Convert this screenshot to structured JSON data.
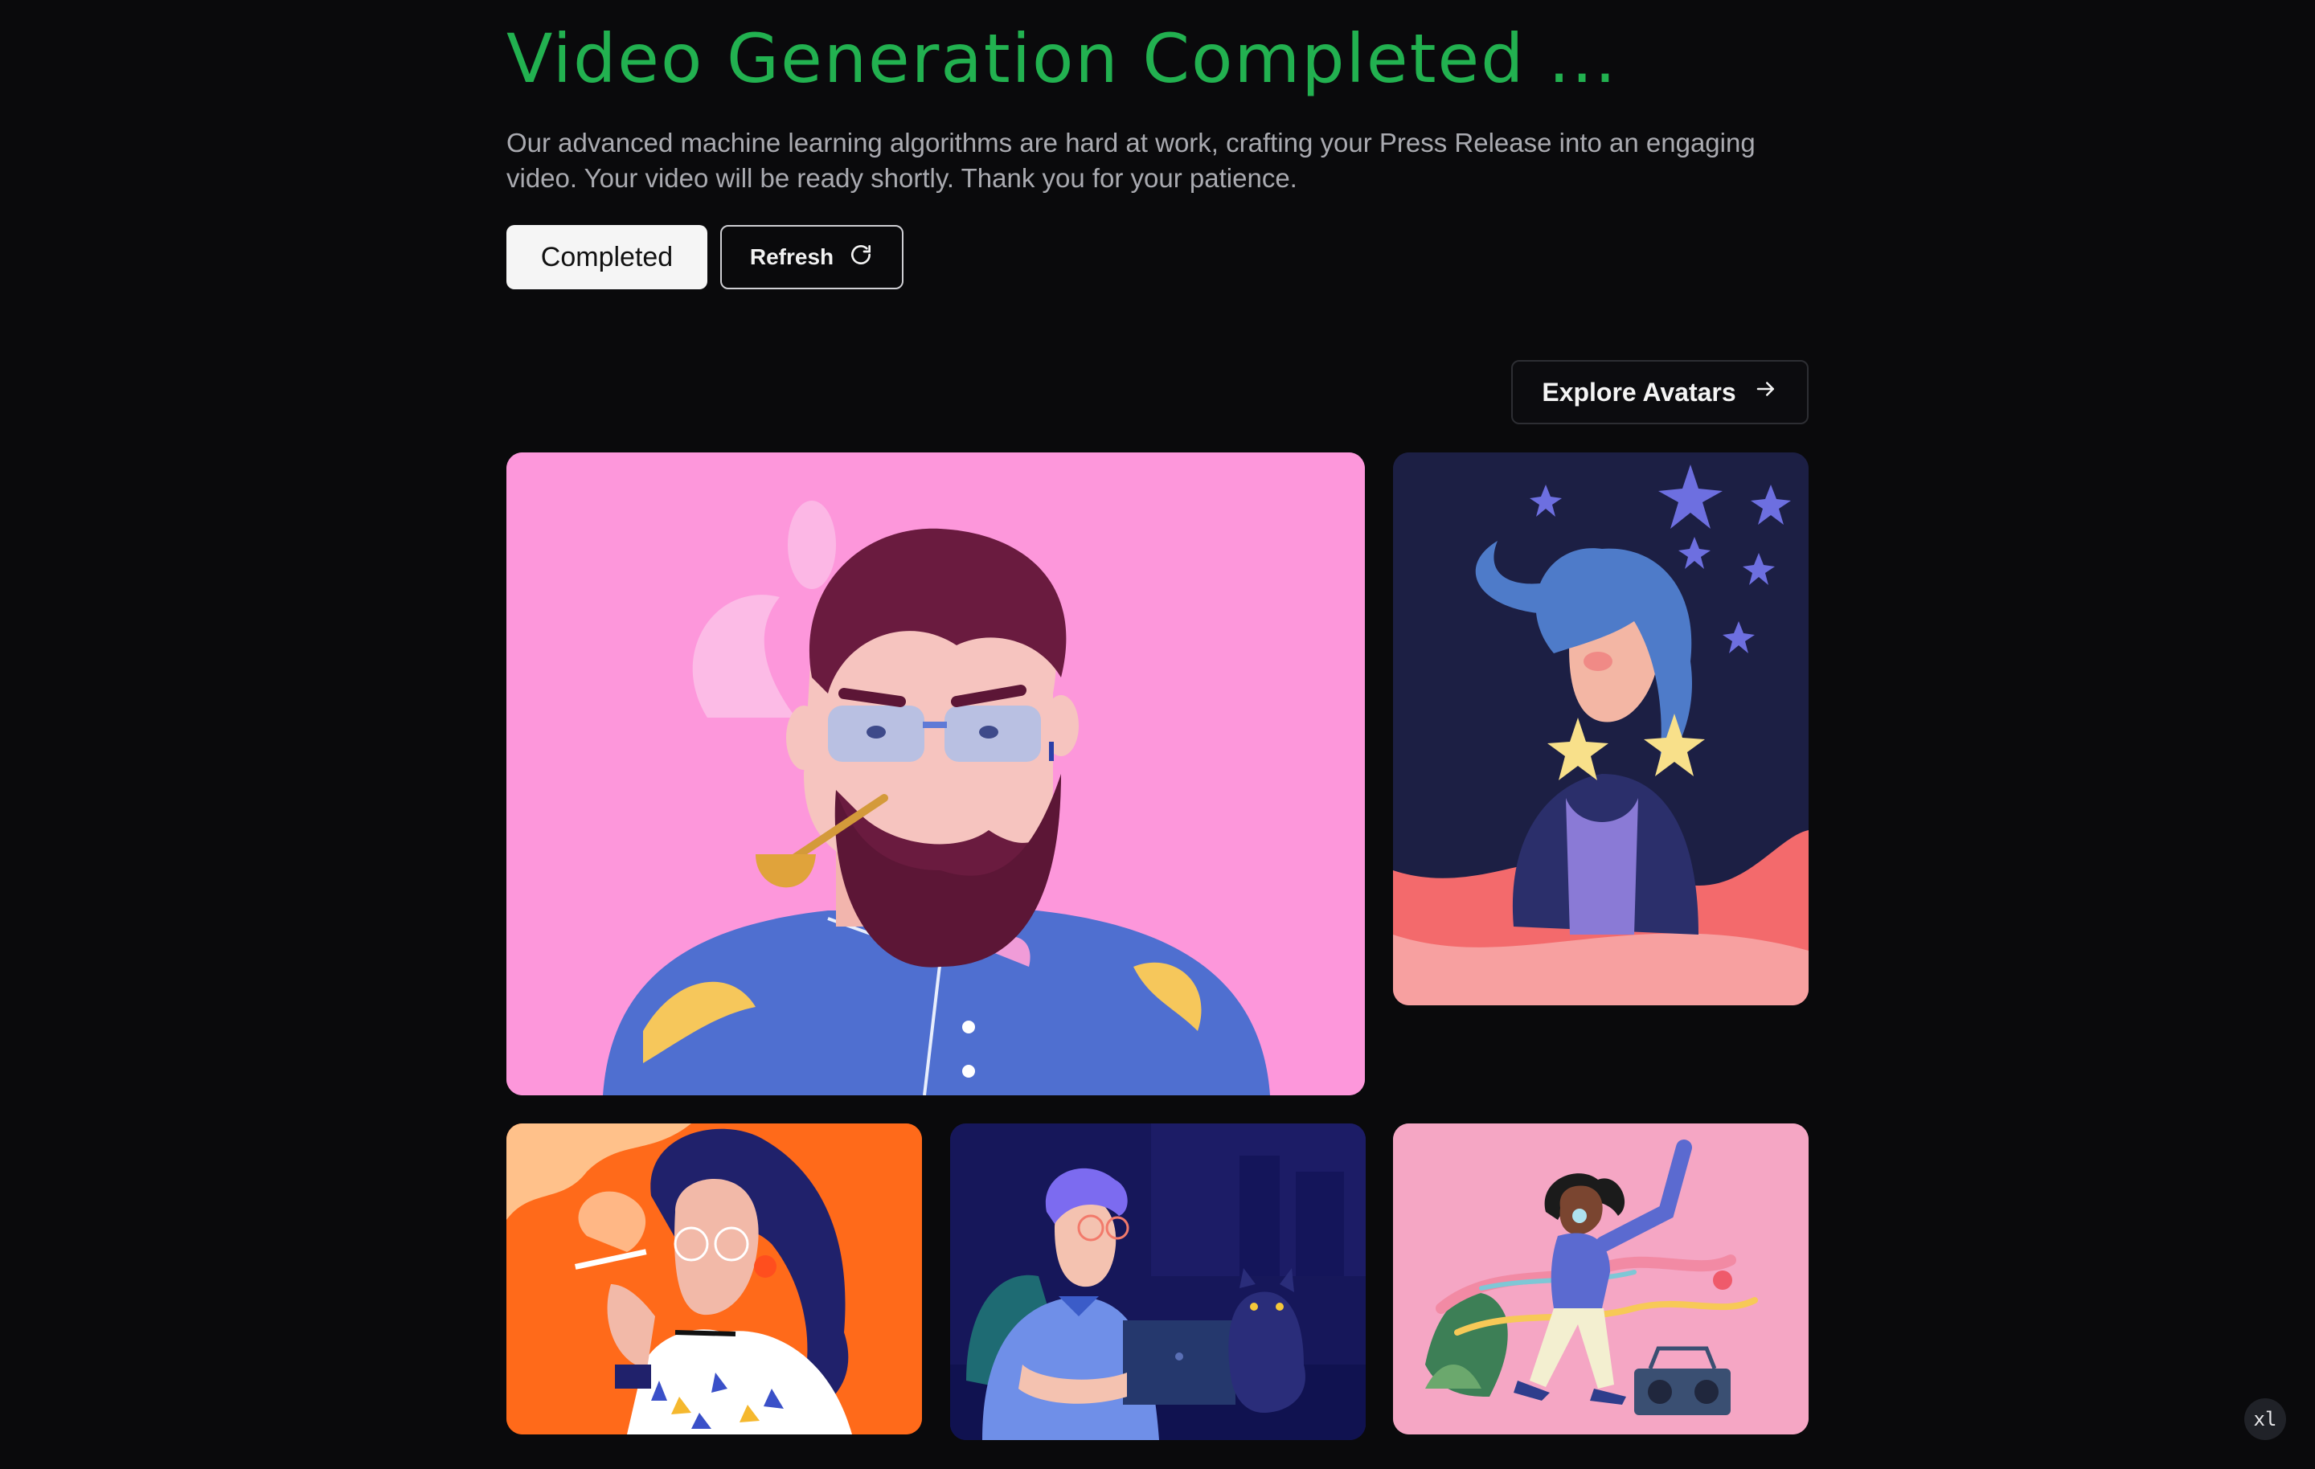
{
  "header": {
    "title": "Video Generation Completed ...",
    "description": "Our advanced machine learning algorithms are hard at work, crafting your Press Release into an engaging video. Your video will be ready shortly. Thank you for your patience."
  },
  "status_button": {
    "label": "Completed"
  },
  "refresh_button": {
    "label": "Refresh",
    "icon": "refresh-icon"
  },
  "explore_button": {
    "label": "Explore Avatars",
    "icon": "arrow-right-icon"
  },
  "gallery": {
    "items": [
      {
        "name": "avatar-bearded-man-pipe",
        "background": "#fd97db"
      },
      {
        "name": "avatar-woman-stars",
        "background": "#1c1f44"
      },
      {
        "name": "avatar-woman-smoking",
        "background": "#ff6a1a"
      },
      {
        "name": "avatar-man-laptop-cat",
        "background": "#16175a"
      },
      {
        "name": "avatar-woman-dancing-boombox",
        "background": "#f5a6c4"
      }
    ]
  },
  "corner_badge": {
    "label": "xl"
  },
  "colors": {
    "accent": "#22b150",
    "background": "#0a0a0c"
  }
}
